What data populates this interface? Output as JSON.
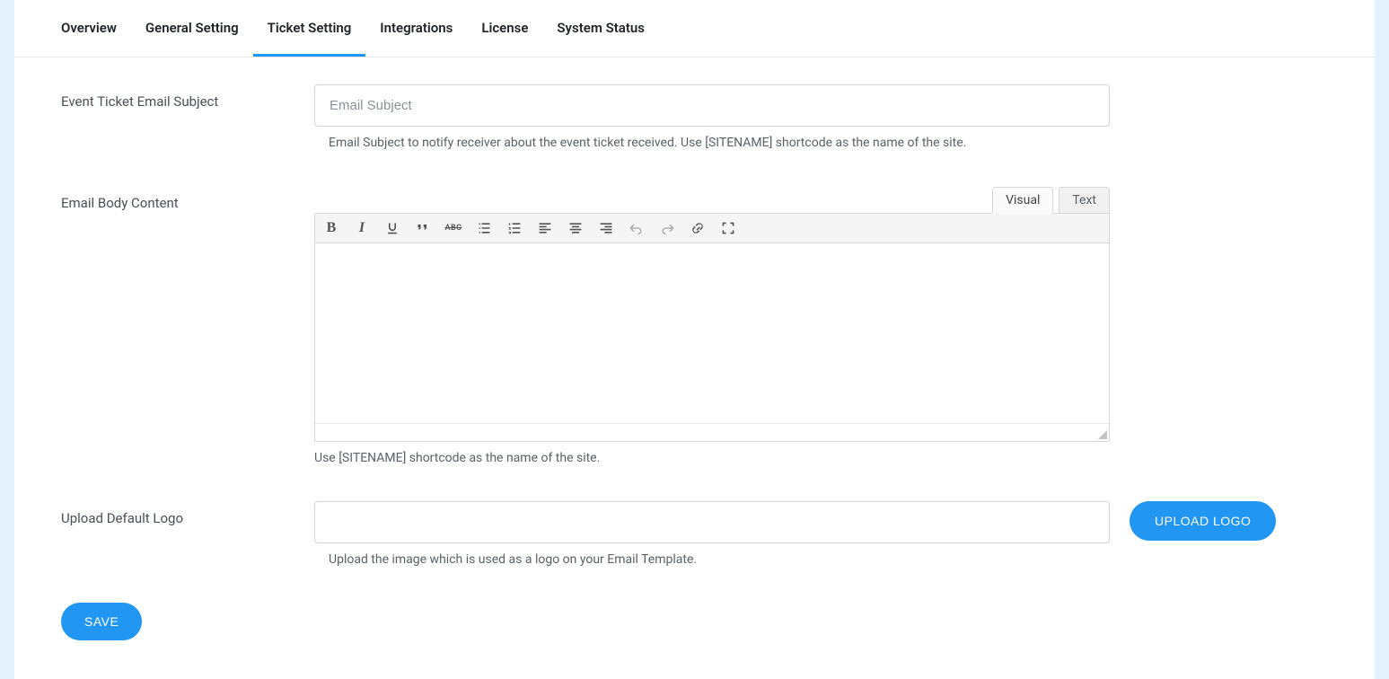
{
  "tabs": {
    "overview": "Overview",
    "general": "General Setting",
    "ticket": "Ticket Setting",
    "integrations": "Integrations",
    "license": "License",
    "system": "System Status"
  },
  "fields": {
    "subject": {
      "label": "Event Ticket Email Subject",
      "placeholder": "Email Subject",
      "help": "Email Subject to notify receiver about the event ticket received. Use [SITENAME] shortcode as the name of the site."
    },
    "body": {
      "label": "Email Body Content",
      "help": "Use [SITENAME] shortcode as the name of the site."
    },
    "logo": {
      "label": "Upload Default Logo",
      "help": "Upload the image which is used as a logo on your Email Template.",
      "upload_btn": "UPLOAD LOGO"
    }
  },
  "editor_tabs": {
    "visual": "Visual",
    "text": "Text"
  },
  "save_btn": "SAVE"
}
